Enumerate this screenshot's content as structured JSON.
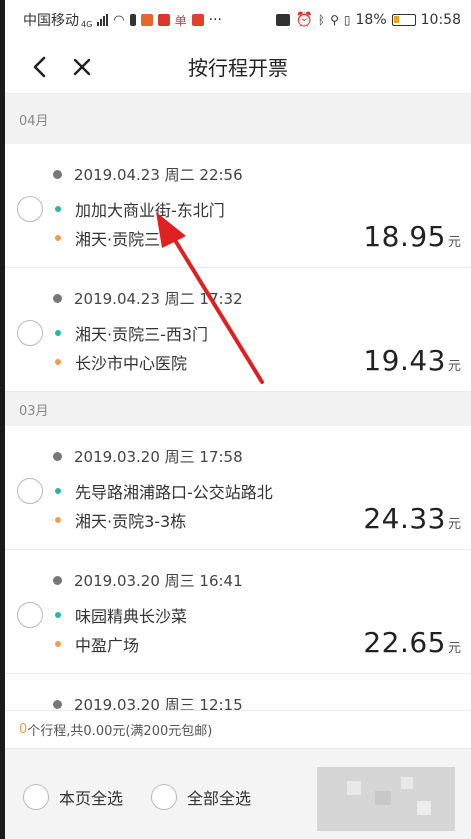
{
  "status_bar": {
    "carrier": "中国移动",
    "network": "4G",
    "more": "···",
    "battery_percent": "18%",
    "time": "10:58"
  },
  "nav": {
    "back_icon": "chevron-left-icon",
    "close_icon": "close-icon",
    "title": "按行程开票"
  },
  "groups": [
    {
      "month": "04月",
      "trips": [
        {
          "time": "2019.04.23 周二 22:56",
          "from": "加加大商业街-东北门",
          "to": "湘天·贡院三",
          "price": "18.95",
          "unit": "元"
        },
        {
          "time": "2019.04.23 周二 17:32",
          "from": "湘天·贡院三-西3门",
          "to": "长沙市中心医院",
          "price": "19.43",
          "unit": "元"
        }
      ]
    },
    {
      "month": "03月",
      "trips": [
        {
          "time": "2019.03.20 周三 17:58",
          "from": "先导路湘浦路口-公交站路北",
          "to": "湘天·贡院3-3栋",
          "price": "24.33",
          "unit": "元"
        },
        {
          "time": "2019.03.20 周三 16:41",
          "from": "味园精典长沙菜",
          "to": "中盈广场",
          "price": "22.65",
          "unit": "元"
        },
        {
          "time": "2019.03.20 周三 12:15",
          "from": "",
          "to": "",
          "price": "",
          "unit": ""
        }
      ]
    }
  ],
  "summary": {
    "count": "0",
    "text": "个行程,共0.00元(满200元包邮)"
  },
  "bottom": {
    "select_page": "本页全选",
    "select_all": "全部全选"
  },
  "colors": {
    "from_dot": "#26b8a3",
    "to_dot": "#f39c4e",
    "annotation_arrow": "#e02020"
  }
}
